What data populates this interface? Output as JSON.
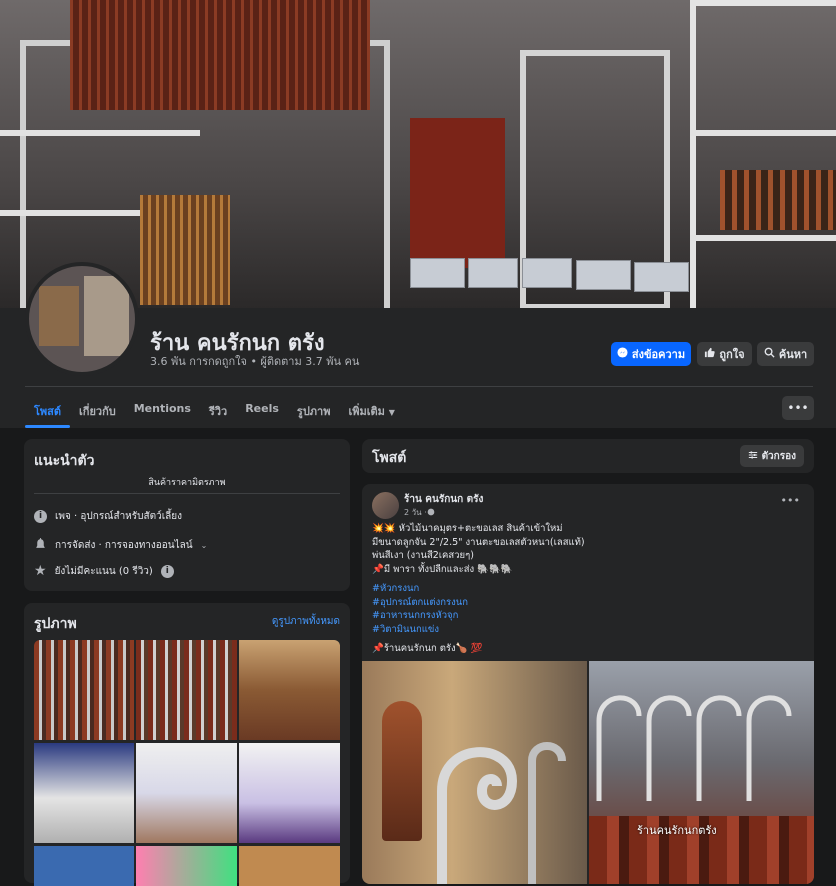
{
  "page": {
    "name": "ร้าน คนรักนก ตรัง",
    "stats": "3.6 พัน การกดถูกใจ • ผู้ติดตาม 3.7 พัน คน"
  },
  "actions": {
    "message": "ส่งข้อความ",
    "like": "ถูกใจ",
    "search": "ค้นหา"
  },
  "tabs": [
    "โพสต์",
    "เกี่ยวกับ",
    "Mentions",
    "รีวิว",
    "Reels",
    "รูปภาพ",
    "เพิ่มเติม"
  ],
  "more_icon": "more-dots-icon",
  "intro": {
    "title": "แนะนำตัว",
    "bio": "สินค้าราคามิตรภาพ",
    "items": [
      {
        "icon": "info-icon",
        "text": "เพจ · อุปกรณ์สำหรับสัตว์เลี้ยง"
      },
      {
        "icon": "bell-icon",
        "text": "การจัดส่ง · การจองทางออนไลน์"
      },
      {
        "icon": "star-icon",
        "text": "ยังไม่มีคะแนน (0 รีวิว)"
      }
    ]
  },
  "photos_card": {
    "title": "รูปภาพ",
    "see_all": "ดูรูปภาพทั้งหมด"
  },
  "posts": {
    "title": "โพสต์",
    "filter": "ตัวกรอง",
    "post": {
      "author": "ร้าน คนรักนก ตรัง",
      "time": "2 วัน · ",
      "lines": [
        "💥💥 หัวไม้นาคมุตร+ตะขอเลส สินค้าเข้าใหม่",
        "มีขนาดลูกจัน 2\"/2.5\" งานตะขอเลสตัวหนา(เลสแท้)",
        "พ่นสีเงา (งานสี2เคสวยๆ)",
        "📌มี พารา ทั้งปลีกและส่ง 🐘🐘🐘"
      ],
      "hashtags": [
        "#หัวกรงนก",
        "#อุปกรณ์ตกแต่งกรงนก",
        "#อาหารนกกรงหัวจุก",
        "#วิตามินนกแข่ง"
      ],
      "signature": "📌ร้านคนรักนก ตรัง🍗 💯",
      "image_caption": "ร้านคนรักนกตรัง"
    }
  },
  "colors": {
    "accent": "#0866ff",
    "link": "#4599ff",
    "card": "#242526",
    "bg": "#18191a"
  }
}
